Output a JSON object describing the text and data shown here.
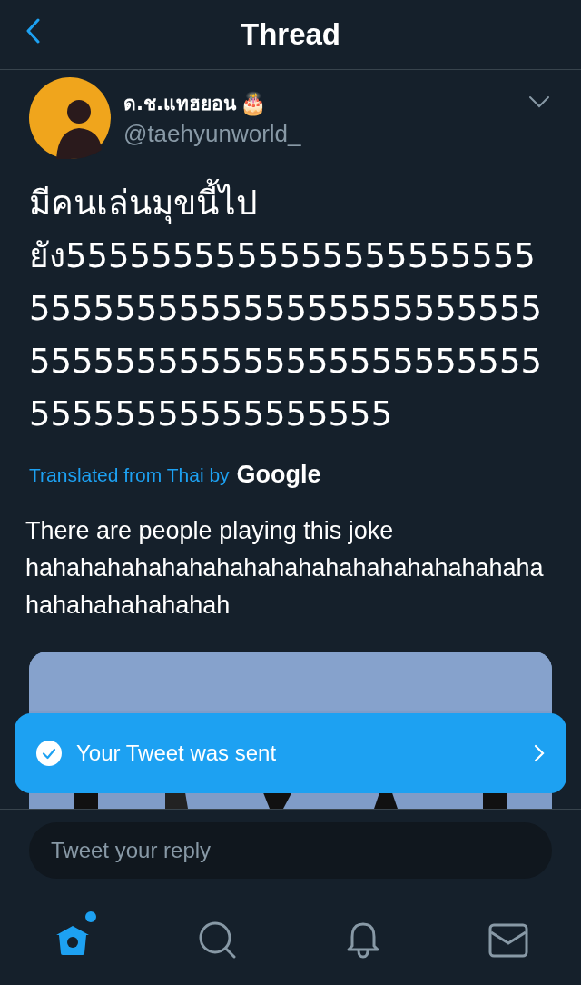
{
  "header": {
    "title": "Thread"
  },
  "tweet": {
    "display_name": "ด.ช.แทฮยอน",
    "name_emoji": "🎂",
    "handle": "@taehyunworld_",
    "text": "มีคนเล่นมุขนี้ไป ยัง555555555555555555555555555555555555555555555555555555555555555555555555555555555555555",
    "translation_label": "Translated from Thai by",
    "translation_brand": "Google",
    "translation": "There are people playing this joke hahahahahahahahahahahahahahahahahahahahahahahahahahah"
  },
  "toast": {
    "text": "Your Tweet was sent"
  },
  "reply": {
    "placeholder": "Tweet your reply"
  },
  "tabs": [
    {
      "kind": "home",
      "selected": true,
      "badge": true
    },
    {
      "kind": "search",
      "selected": false,
      "badge": false
    },
    {
      "kind": "notifications",
      "selected": false,
      "badge": false
    },
    {
      "kind": "messages",
      "selected": false,
      "badge": false
    }
  ]
}
